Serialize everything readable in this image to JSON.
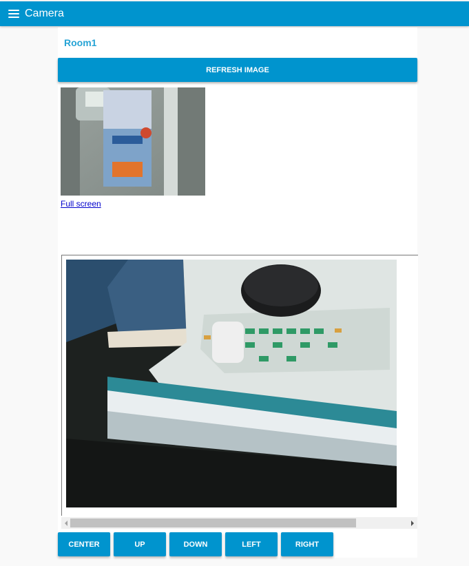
{
  "header": {
    "title": "Camera",
    "menu_icon": "hamburger-menu-icon",
    "color": "#0094ce"
  },
  "group": {
    "title": "Room1"
  },
  "buttons": {
    "refresh": "REFRESH IMAGE",
    "center": "CENTER",
    "up": "UP",
    "down": "DOWN",
    "left": "LEFT",
    "right": "RIGHT"
  },
  "snapshot": {
    "link": "Full screen"
  },
  "stream": {
    "scrollbar_position": 0
  }
}
